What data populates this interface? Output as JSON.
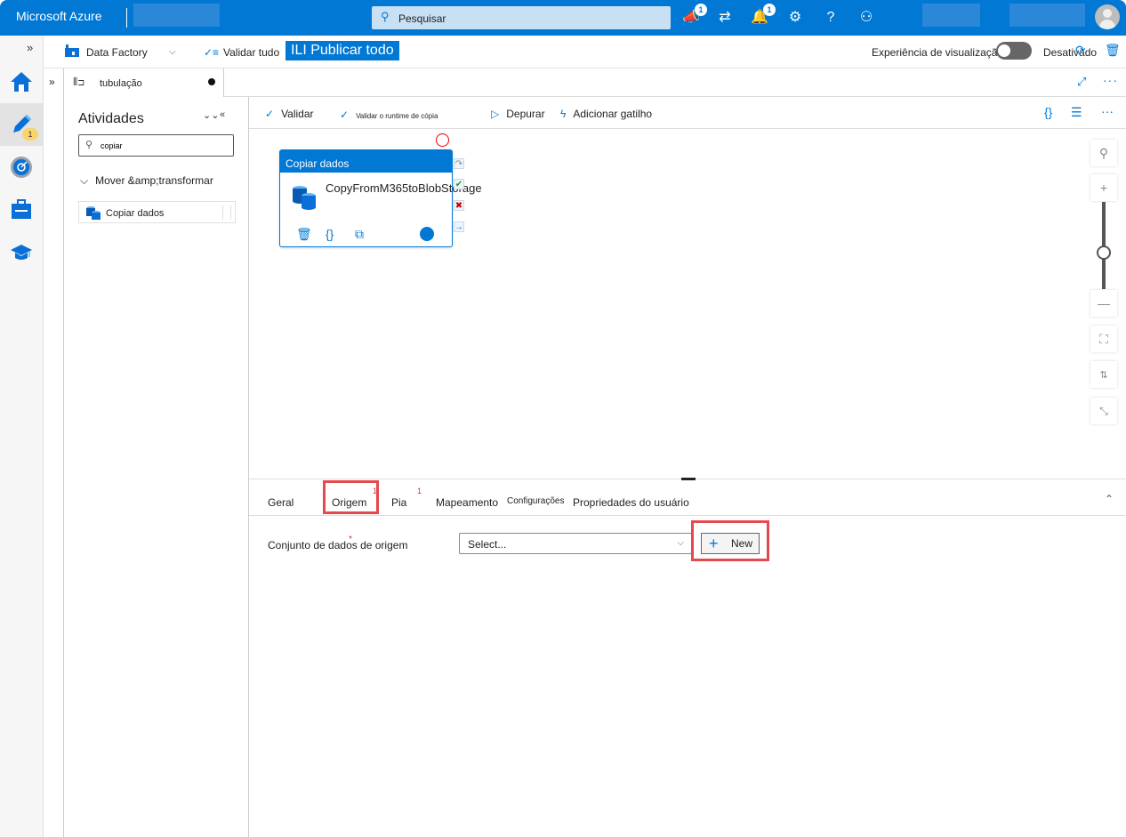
{
  "header": {
    "brand": "Microsoft Azure",
    "search_placeholder": "Pesquisar",
    "notifications_badge": "1",
    "feedback_badge": "1"
  },
  "factory_bar": {
    "factory_name": "Data Factory",
    "validate_all": "Validar tudo",
    "publish_all": "ILI  Publicar todo",
    "preview_label": "Experiência de visualização",
    "preview_state": "Desativado"
  },
  "rail": {
    "author_badge": "1"
  },
  "tab": {
    "label": "tubulação"
  },
  "activities": {
    "title": "Atividades",
    "search_value": "copiar",
    "group": "Mover &amp;transformar",
    "item": "Copiar dados"
  },
  "canvas_toolbar": {
    "validate": "Validar",
    "validate_runtime": "Validar o runtime de cópia",
    "debug": "Depurar",
    "add_trigger": "Adicionar gatilho"
  },
  "node": {
    "type": "Copiar dados",
    "name": "CopyFromM365toBlobStorage"
  },
  "properties": {
    "tabs": [
      {
        "label": "Geral"
      },
      {
        "label": "Origem",
        "badge": "1"
      },
      {
        "label": "Pia",
        "badge": "1"
      },
      {
        "label": "Mapeamento"
      },
      {
        "label": "Configurações"
      },
      {
        "label": "Propriedades do usuário"
      }
    ],
    "source_dataset_label": "Conjunto de dados de origem",
    "select_placeholder": "Select...",
    "new_button": "New"
  }
}
